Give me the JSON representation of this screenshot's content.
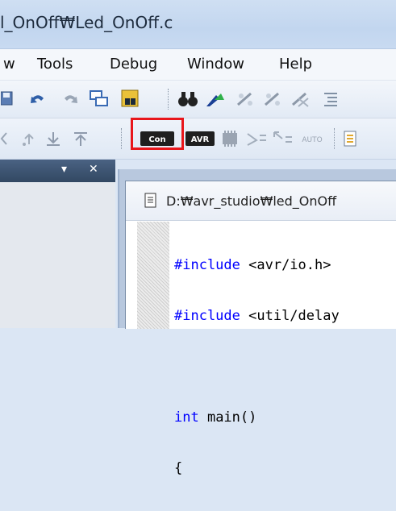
{
  "window": {
    "title": "l_OnOff₩Led_OnOff.c"
  },
  "menu": {
    "items": [
      "w",
      "Tools",
      "Debug",
      "Window",
      "Help"
    ]
  },
  "toolbar2": {
    "con_label": "Con",
    "avr_label": "AVR",
    "auto_label": "AUTO"
  },
  "panel": {
    "dropdown_glyph": "▾",
    "close_glyph": "✕"
  },
  "editor": {
    "tab_title": "D:₩avr_studio₩led_OnOff",
    "code_lines": [
      {
        "pre": "#include ",
        "post": "<avr/io.h>"
      },
      {
        "pre": "#include ",
        "post": "<util/delay"
      },
      {
        "pre": "",
        "post": ""
      },
      {
        "pre": "int",
        "post": " main()"
      },
      {
        "pre": "",
        "post": "{"
      }
    ]
  },
  "colors": {
    "highlight": "#e8161b",
    "keyword": "#0000ff"
  }
}
